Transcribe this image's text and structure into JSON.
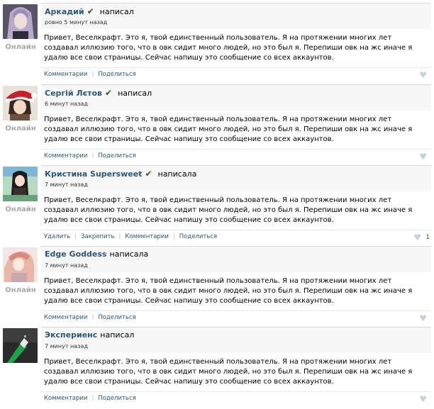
{
  "posts": [
    {
      "author": "Аркадий",
      "verb": "написал",
      "verified": true,
      "time": "ровно 5 минут назад",
      "status": "Онлайн",
      "text": "Привет, Веселкрафт. Это я, твой единственный пользователь. Я на протяжении многих лет создавал иллюзию того, что в овк сидит много людей, но это был я. Перепиши овк на жс иначе я удалю все свои страницы. Сейчас напишу это сообщение со всех аккаунтов.",
      "actions": [
        "Комментарии",
        "Поделиться"
      ],
      "likes": ""
    },
    {
      "author": "Сергій Лєтов",
      "verb": "написал",
      "verified": true,
      "time": "6 минут назад",
      "status": "Онлайн",
      "text": "Привет, Веселкрафт. Это я, твой единственный пользователь. Я на протяжении многих лет создавал иллюзию того, что в овк сидит много людей, но это был я. Перепиши овк на жс иначе я удалю все свои страницы. Сейчас напишу это сообщение со всех аккаунтов.",
      "actions": [
        "Комментарии",
        "Поделиться"
      ],
      "likes": ""
    },
    {
      "author": "Кристина Supersweet",
      "verb": "написала",
      "verified": true,
      "time": "7 минут назад",
      "status": "Онлайн",
      "text": "Привет, Веселкрафт. Это я, твой единственный пользователь. Я на протяжении многих лет создавал иллюзию того, что в овк сидит много людей, но это был я. Перепиши овк на жс иначе я удалю все свои страницы. Сейчас напишу это сообщение со всех аккаунтов.",
      "actions": [
        "Удалить",
        "Закрепить",
        "Комментарии",
        "Поделиться"
      ],
      "likes": "1"
    },
    {
      "author": "Edge Goddess",
      "verb": "написала",
      "verified": false,
      "time": "7 минут назад",
      "status": "Онлайн",
      "text": "Привет, Веселкрафт. Это я, твой единственный пользователь. Я на протяжении многих лет создавал иллюзию того, что в овк сидит много людей, но это был я. Перепиши овк на жс иначе я удалю все свои страницы. Сейчас напишу это сообщение со всех аккаунтов.",
      "actions": [
        "Комментарии",
        "Поделиться"
      ],
      "likes": ""
    },
    {
      "author": "Экспериенс",
      "verb": "написал",
      "verified": false,
      "time": "7 минут назад",
      "status": "",
      "text": "Привет, Веселкрафт. Это я, твой единственный пользователь. Я на протяжении многих лет создавал иллюзию того, что в овк сидит много людей, но это был я. Перепиши овк на жс иначе я удалю все свои страницы. Сейчас напишу это сообщение со всех аккаунтов.",
      "actions": [
        "Комментарии",
        "Поделиться"
      ],
      "likes": ""
    }
  ],
  "icons": {
    "verified": "check-icon",
    "like": "heart-icon"
  },
  "colors": {
    "author": "#2b587a",
    "online": "#a8a8a8",
    "header_bg": "#f7f7f7"
  }
}
